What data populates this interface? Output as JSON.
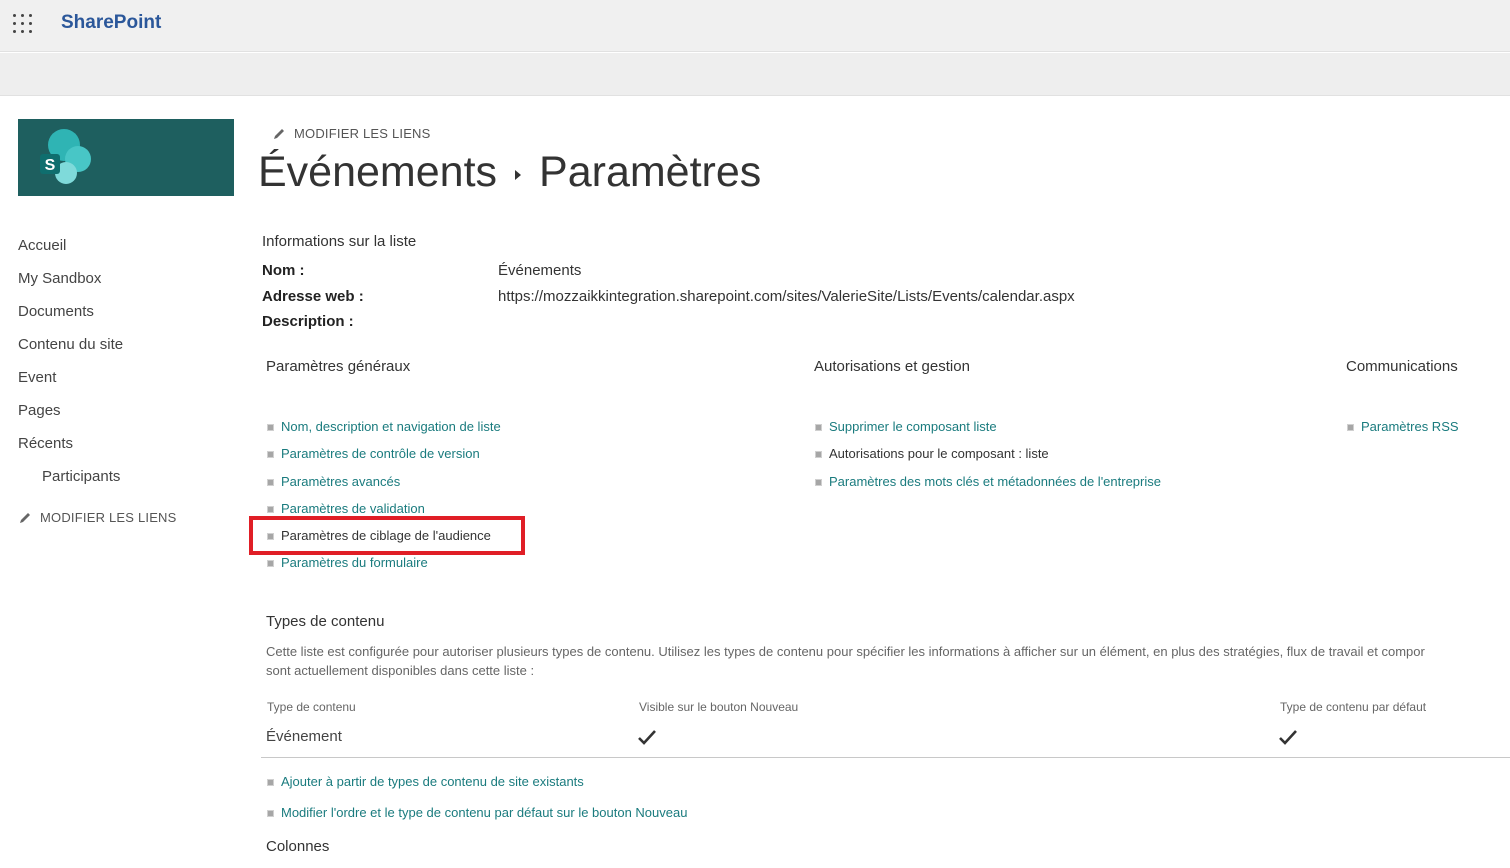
{
  "app": {
    "brand": "SharePoint"
  },
  "nav": {
    "items": [
      "Accueil",
      "My Sandbox",
      "Documents",
      "Contenu du site",
      "Event",
      "Pages",
      "Récents"
    ],
    "sub_items": [
      "Participants"
    ],
    "edit_links": "MODIFIER LES LIENS"
  },
  "header": {
    "edit_links": "MODIFIER LES LIENS",
    "breadcrumb_list": "Événements",
    "breadcrumb_page": "Paramètres"
  },
  "info": {
    "heading": "Informations sur la liste",
    "name_label": "Nom :",
    "name_value": "Événements",
    "url_label": "Adresse web :",
    "url_value": "https://mozzaikkintegration.sharepoint.com/sites/ValerieSite/Lists/Events/calendar.aspx",
    "desc_label": "Description :"
  },
  "general": {
    "heading": "Paramètres généraux",
    "links": [
      "Nom, description et navigation de liste",
      "Paramètres de contrôle de version",
      "Paramètres avancés",
      "Paramètres de validation",
      "Paramètres de ciblage de l'audience",
      "Paramètres du formulaire"
    ]
  },
  "permissions": {
    "heading": "Autorisations et gestion",
    "links": [
      "Supprimer le composant liste",
      "Autorisations pour le composant : liste",
      "Paramètres des mots clés et métadonnées de l'entreprise"
    ]
  },
  "communications": {
    "heading": "Communications",
    "links": [
      "Paramètres RSS"
    ]
  },
  "content_types": {
    "heading": "Types de contenu",
    "description_line1": "Cette liste est configurée pour autoriser plusieurs types de contenu. Utilisez les types de contenu pour spécifier les informations à afficher sur un élément, en plus des stratégies, flux de travail et compor",
    "description_line2": "sont actuellement disponibles dans cette liste :",
    "col_type": "Type de contenu",
    "col_visible": "Visible sur le bouton Nouveau",
    "col_default": "Type de contenu par défaut",
    "row_name": "Événement",
    "links": [
      "Ajouter à partir de types de contenu de site existants",
      "Modifier l'ordre et le type de contenu par défaut sur le bouton Nouveau"
    ]
  },
  "columns": {
    "heading": "Colonnes"
  },
  "colors": {
    "brand": "#2b579a",
    "link": "#1a7b7e",
    "highlight": "#e01e26",
    "logo_bg": "#1e5f5f"
  }
}
